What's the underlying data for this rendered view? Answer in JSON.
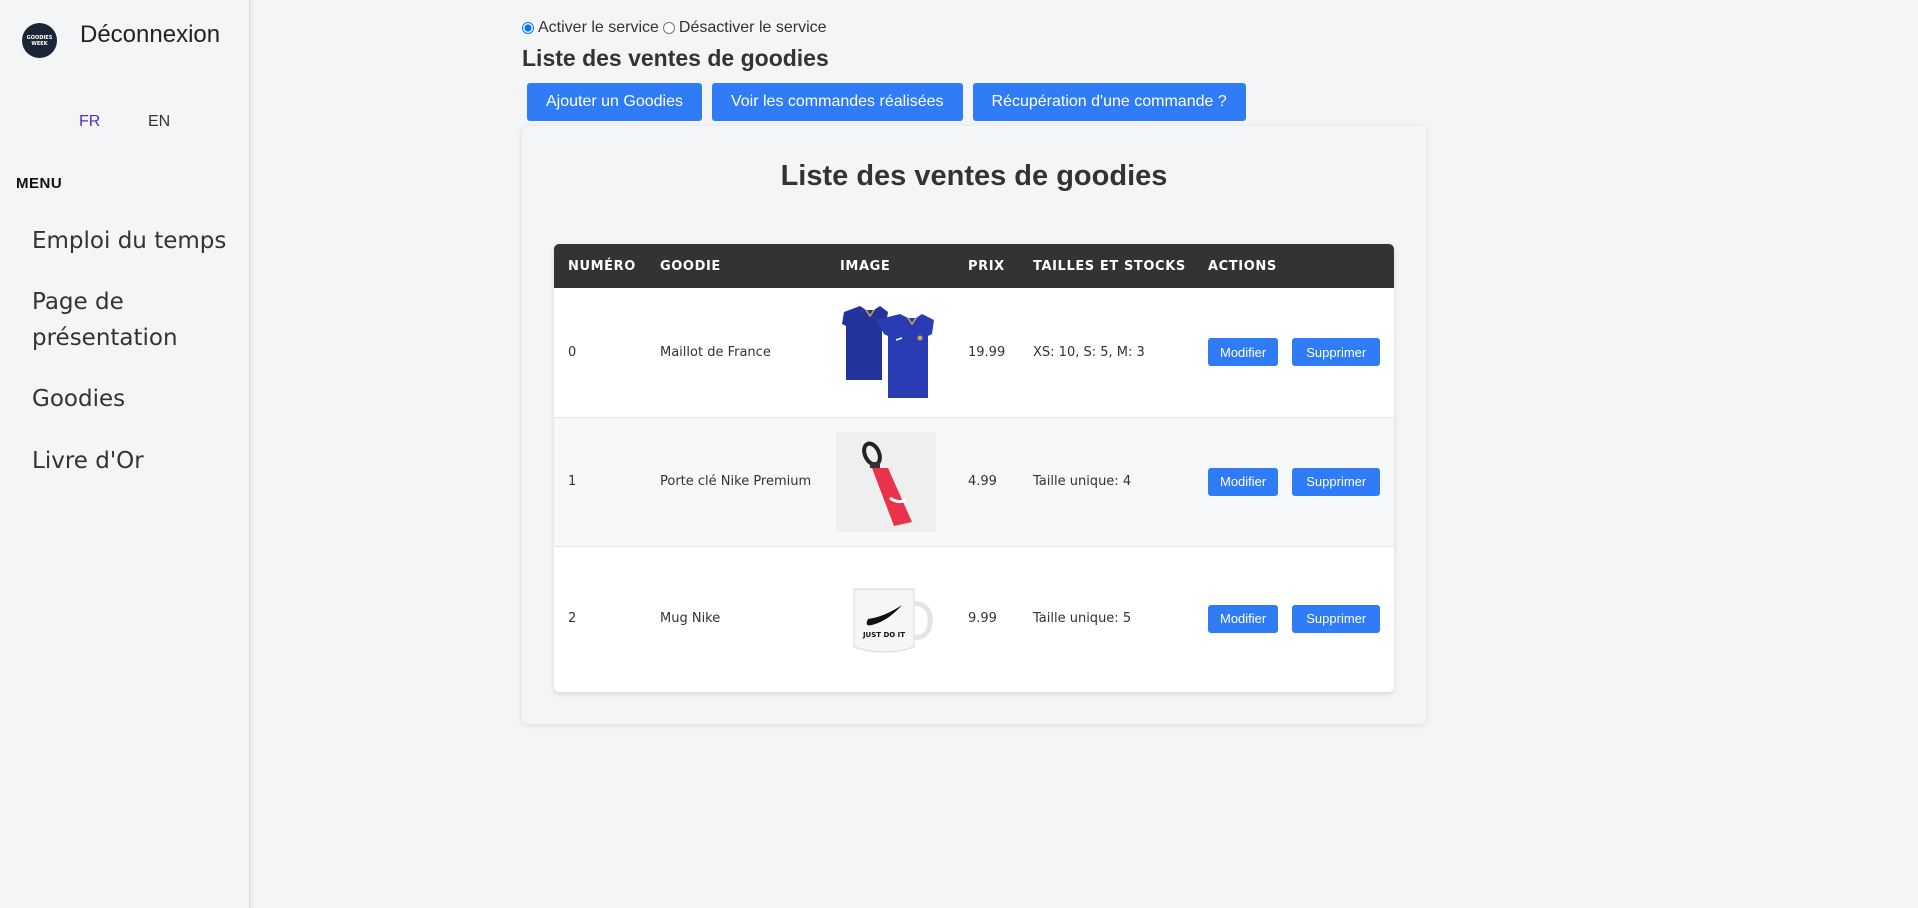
{
  "sidebar": {
    "logo_text": "GOODIES WEEK",
    "logout_label": "Déconnexion",
    "languages": [
      "FR",
      "EN"
    ],
    "menu_title": "MENU",
    "items": [
      {
        "label": "Emploi du temps"
      },
      {
        "label": "Page de présentation"
      },
      {
        "label": "Goodies"
      },
      {
        "label": "Livre d'Or"
      }
    ]
  },
  "service": {
    "enable_label": "Activer le service",
    "disable_label": "Désactiver le service",
    "selected": "enable"
  },
  "header": {
    "title": "Liste des ventes de goodies",
    "buttons": {
      "add": "Ajouter un Goodies",
      "orders": "Voir les commandes réalisées",
      "retrieve": "Récupération d'une commande ?"
    }
  },
  "card": {
    "title": "Liste des ventes de goodies"
  },
  "table": {
    "columns": [
      "NUMÉRO",
      "GOODIE",
      "IMAGE",
      "PRIX",
      "TAILLES ET STOCKS",
      "ACTIONS"
    ],
    "rows": [
      {
        "num": "0",
        "goodie": "Maillot de France",
        "image": "blue-jersey",
        "prix": "19.99",
        "tailles": "XS: 10, S: 5, M: 3"
      },
      {
        "num": "1",
        "goodie": "Porte clé Nike Premium",
        "image": "keychain",
        "prix": "4.99",
        "tailles": "Taille unique: 4"
      },
      {
        "num": "2",
        "goodie": "Mug Nike",
        "image": "mug",
        "prix": "9.99",
        "tailles": "Taille unique: 5"
      }
    ],
    "action_labels": {
      "edit": "Modifier",
      "delete": "Supprimer"
    }
  },
  "mug_print": "JUST DO IT",
  "colors": {
    "accent": "#2f7cf6",
    "table_header": "#333333",
    "lang_active": "#5a2bc4"
  }
}
